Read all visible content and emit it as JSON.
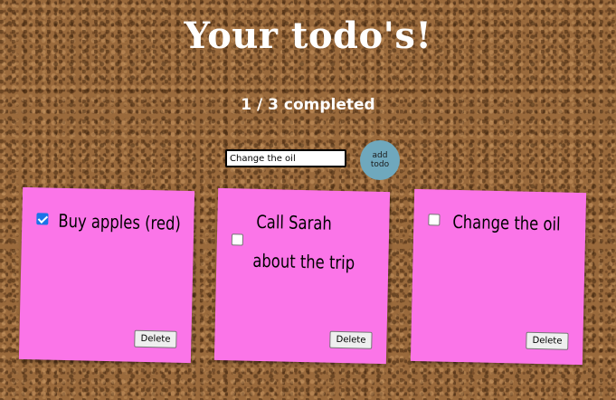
{
  "page": {
    "title": "Your todo's!",
    "completed_count": "1",
    "separator": " / ",
    "total_count": "3",
    "completed_label": " completed"
  },
  "new_todo": {
    "value": "Change the oil",
    "add_label_line1": "add",
    "add_label_line2": "todo"
  },
  "todos": [
    {
      "line1": "Buy apples (red)",
      "line2": "",
      "completed": true,
      "delete_label": "Delete"
    },
    {
      "line1": "Call Sarah",
      "line2": "about the trip",
      "completed": false,
      "delete_label": "Delete"
    },
    {
      "line1": "Change the oil",
      "line2": "",
      "completed": false,
      "delete_label": "Delete"
    }
  ],
  "colors": {
    "note": "#fb75e8",
    "add_button": "#6fa8bd",
    "checkbox_checked": "#1a73e8"
  }
}
